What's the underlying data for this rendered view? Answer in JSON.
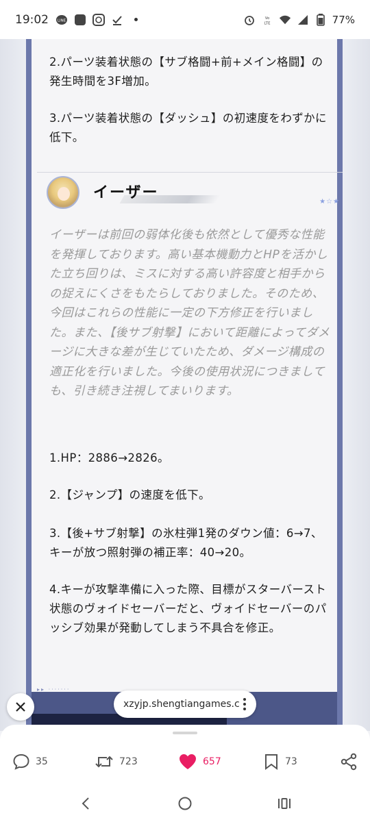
{
  "status_bar": {
    "time": "19:02",
    "battery": "77%",
    "network": "LTE",
    "left_icons": [
      "line-icon",
      "app-icon",
      "shield-icon",
      "check-icon",
      "dot-icon"
    ],
    "right_icons": [
      "alarm-icon",
      "volte-icon",
      "wifi-icon",
      "signal-icon",
      "battery-icon"
    ]
  },
  "article": {
    "top_items": [
      "2.パーツ装着状態の【サブ格闘+前+メイン格闘】の発生時間を3F増加。",
      "3.パーツ装着状態の【ダッシュ】の初速度をわずかに低下。"
    ],
    "character": {
      "name": "イーザー",
      "stars": "★☆★"
    },
    "description": "イーザーは前回の弱体化後も依然として優秀な性能を発揮しております。高い基本機動力とHPを活かした立ち回りは、ミスに対する高い許容度と相手からの捉えにくさをもたらしておりました。そのため、今回はこれらの性能に一定の下方修正を行いました。また、【後サブ射撃】において距離によってダメージに大きな差が生じていたため、ダメージ構成の適正化を行いました。今後の使用状況につきましても、引き続き注視してまいります。",
    "changes": [
      "1.HP：2886→2826。",
      "2.【ジャンプ】の速度を低下。",
      "3.【後+サブ射撃】の氷柱弾1発のダウン値：6→7、キーが放つ照射弾の補正率：40→20。",
      "4.キーが攻撃準備に入った際、目標がスターバースト状態のヴォイドセーバーだと、ヴォイドセーバーのパッシブ効果が発動してしまう不具合を修正。"
    ]
  },
  "link_pill": {
    "url": "xzyjp.shengtiangames.c..."
  },
  "actions": {
    "reply_count": "35",
    "repost_count": "723",
    "like_count": "657",
    "bookmark_count": "73"
  },
  "colors": {
    "frame": "#6c78ab",
    "like": "#e91e63",
    "italic_text": "#9a9a9a"
  }
}
